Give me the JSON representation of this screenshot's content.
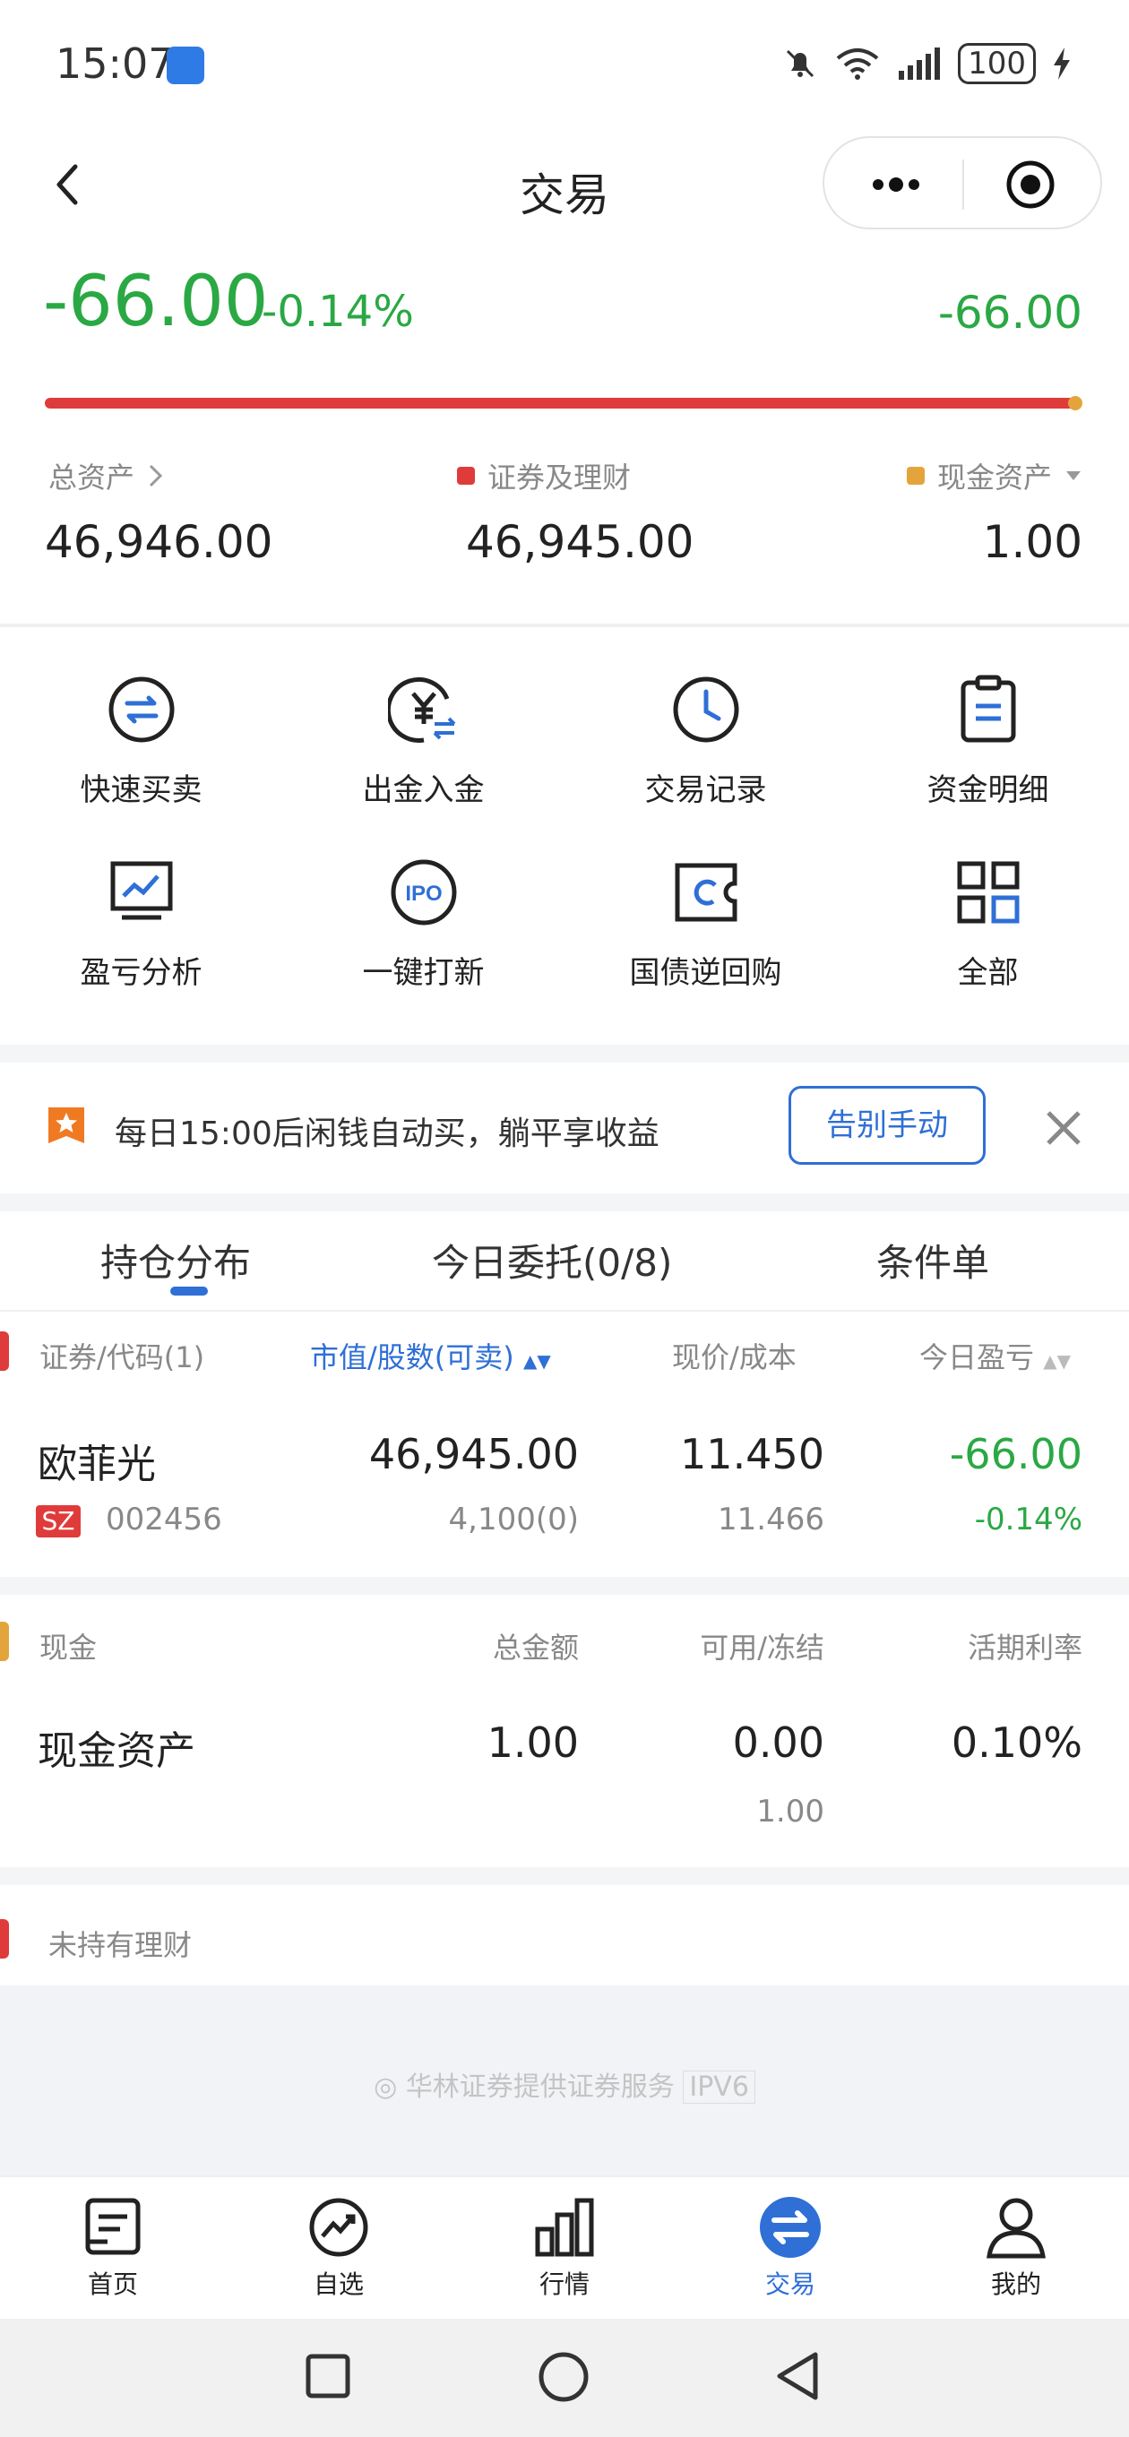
{
  "status_bar": {
    "time": "15:07",
    "battery": "100"
  },
  "header": {
    "title": "交易"
  },
  "summary": {
    "pnl": "-66.00",
    "pnl_pct": "-0.14%",
    "pnl_right": "-66.00",
    "securities_ratio": 0.99998,
    "total_assets_label": "总资产",
    "total_assets": "46,946.00",
    "securities_label": "证券及理财",
    "securities_value": "46,945.00",
    "cash_label": "现金资产",
    "cash_value": "1.00"
  },
  "shortcuts": [
    {
      "label": "快速买卖",
      "icon": "swap-icon"
    },
    {
      "label": "出金入金",
      "icon": "yuan-transfer-icon"
    },
    {
      "label": "交易记录",
      "icon": "clock-icon"
    },
    {
      "label": "资金明细",
      "icon": "clipboard-icon"
    },
    {
      "label": "盈亏分析",
      "icon": "chart-monitor-icon"
    },
    {
      "label": "一键打新",
      "icon": "ipo-icon"
    },
    {
      "label": "国债逆回购",
      "icon": "repo-icon"
    },
    {
      "label": "全部",
      "icon": "grid-icon"
    }
  ],
  "banner": {
    "text": "每日15:00后闲钱自动买，躺平享收益",
    "button": "告别手动"
  },
  "tabs": [
    "持仓分布",
    "今日委托(0/8)",
    "条件单"
  ],
  "holdings": {
    "headers": [
      "证券/代码(1)",
      "市值/股数(可卖)",
      "现价/成本",
      "今日盈亏"
    ],
    "rows": [
      {
        "name": "欧菲光",
        "market": "SZ",
        "code": "002456",
        "market_value": "46,945.00",
        "shares": "4,100(0)",
        "price": "11.450",
        "cost": "11.466",
        "pnl": "-66.00",
        "pnl_pct": "-0.14%"
      }
    ]
  },
  "cash": {
    "headers": [
      "现金",
      "总金额",
      "可用/冻结",
      "活期利率"
    ],
    "row": {
      "name": "现金资产",
      "total": "1.00",
      "available": "0.00",
      "frozen": "1.00",
      "rate": "0.10%"
    }
  },
  "wealth": {
    "label": "未持有理财"
  },
  "footer": {
    "text": "华林证券提供证券服务",
    "badge": "IPV6"
  },
  "bottom_nav": [
    "首页",
    "自选",
    "行情",
    "交易",
    "我的"
  ],
  "colors": {
    "accent": "#2f6fd6",
    "loss": "#2aa844",
    "red": "#e03b3b",
    "gold": "#e3a53b"
  }
}
